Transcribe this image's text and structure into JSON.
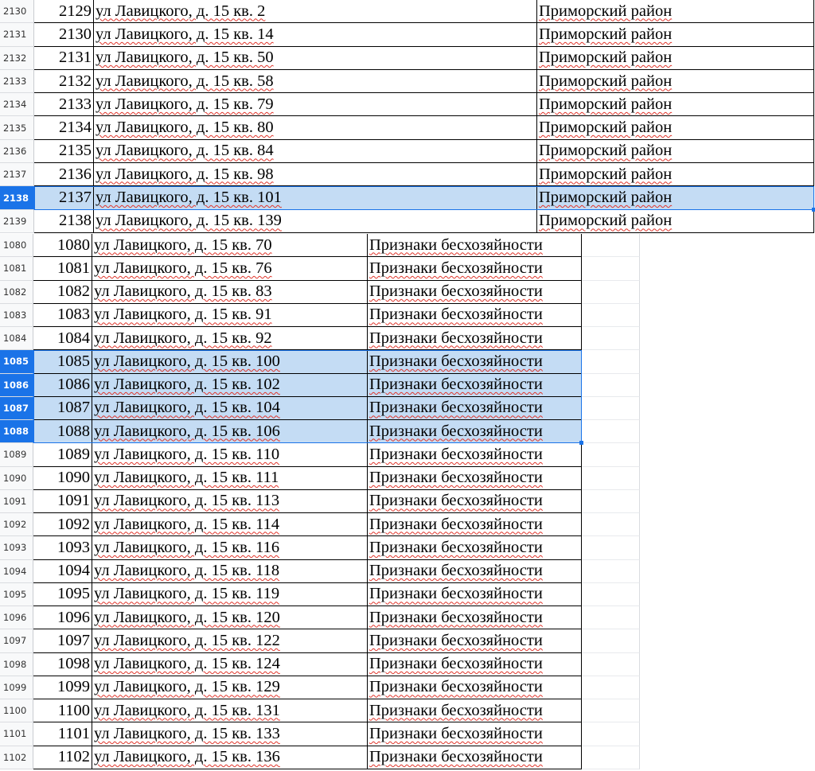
{
  "top_block": {
    "rows": [
      {
        "row": "2130",
        "num": "2129",
        "address": "ул Лавицкого, д. 15 кв. 2",
        "district": "Приморский район",
        "selected": false
      },
      {
        "row": "2131",
        "num": "2130",
        "address": "ул Лавицкого, д. 15 кв. 14",
        "district": "Приморский район",
        "selected": false
      },
      {
        "row": "2132",
        "num": "2131",
        "address": "ул Лавицкого, д. 15 кв. 50",
        "district": "Приморский район",
        "selected": false
      },
      {
        "row": "2133",
        "num": "2132",
        "address": "ул Лавицкого, д. 15 кв. 58",
        "district": "Приморский район",
        "selected": false
      },
      {
        "row": "2134",
        "num": "2133",
        "address": "ул Лавицкого, д. 15 кв. 79",
        "district": "Приморский район",
        "selected": false
      },
      {
        "row": "2135",
        "num": "2134",
        "address": "ул Лавицкого, д. 15 кв. 80",
        "district": "Приморский район",
        "selected": false
      },
      {
        "row": "2136",
        "num": "2135",
        "address": "ул Лавицкого, д. 15 кв. 84",
        "district": "Приморский район",
        "selected": false
      },
      {
        "row": "2137",
        "num": "2136",
        "address": "ул Лавицкого, д. 15 кв. 98",
        "district": "Приморский район",
        "selected": false
      },
      {
        "row": "2138",
        "num": "2137",
        "address": "ул Лавицкого, д. 15 кв. 101",
        "district": "Приморский район",
        "selected": true
      },
      {
        "row": "2139",
        "num": "2138",
        "address": "ул Лавицкого, д. 15 кв. 139",
        "district": "Приморский район",
        "selected": false
      }
    ]
  },
  "bottom_block": {
    "rows": [
      {
        "row": "1080",
        "num": "1080",
        "address": "ул Лавицкого, д. 15 кв. 70",
        "status": "Признаки бесхозяйности",
        "selected": false
      },
      {
        "row": "1081",
        "num": "1081",
        "address": "ул Лавицкого, д. 15 кв. 76",
        "status": "Признаки бесхозяйности",
        "selected": false
      },
      {
        "row": "1082",
        "num": "1082",
        "address": "ул Лавицкого, д. 15 кв. 83",
        "status": "Признаки бесхозяйности",
        "selected": false
      },
      {
        "row": "1083",
        "num": "1083",
        "address": "ул Лавицкого, д. 15 кв. 91",
        "status": "Признаки бесхозяйности",
        "selected": false
      },
      {
        "row": "1084",
        "num": "1084",
        "address": "ул Лавицкого, д. 15 кв. 92",
        "status": "Признаки бесхозяйности",
        "selected": false
      },
      {
        "row": "1085",
        "num": "1085",
        "address": "ул Лавицкого, д. 15 кв. 100",
        "status": "Признаки бесхозяйности",
        "selected": true
      },
      {
        "row": "1086",
        "num": "1086",
        "address": "ул Лавицкого, д. 15 кв. 102",
        "status": "Признаки бесхозяйности",
        "selected": true
      },
      {
        "row": "1087",
        "num": "1087",
        "address": "ул Лавицкого, д. 15 кв. 104",
        "status": "Признаки бесхозяйности",
        "selected": true
      },
      {
        "row": "1088",
        "num": "1088",
        "address": "ул Лавицкого, д. 15 кв. 106",
        "status": "Признаки бесхозяйности",
        "selected": true
      },
      {
        "row": "1089",
        "num": "1089",
        "address": "ул Лавицкого, д. 15 кв. 110",
        "status": "Признаки бесхозяйности",
        "selected": false
      },
      {
        "row": "1090",
        "num": "1090",
        "address": "ул Лавицкого, д. 15 кв. 111",
        "status": "Признаки бесхозяйности",
        "selected": false
      },
      {
        "row": "1091",
        "num": "1091",
        "address": "ул Лавицкого, д. 15 кв. 113",
        "status": "Признаки бесхозяйности",
        "selected": false
      },
      {
        "row": "1092",
        "num": "1092",
        "address": "ул Лавицкого, д. 15 кв. 114",
        "status": "Признаки бесхозяйности",
        "selected": false
      },
      {
        "row": "1093",
        "num": "1093",
        "address": "ул Лавицкого, д. 15 кв. 116",
        "status": "Признаки бесхозяйности",
        "selected": false
      },
      {
        "row": "1094",
        "num": "1094",
        "address": "ул Лавицкого, д. 15 кв. 118",
        "status": "Признаки бесхозяйности",
        "selected": false
      },
      {
        "row": "1095",
        "num": "1095",
        "address": "ул Лавицкого, д. 15 кв. 119",
        "status": "Признаки бесхозяйности",
        "selected": false
      },
      {
        "row": "1096",
        "num": "1096",
        "address": "ул Лавицкого, д. 15 кв. 120",
        "status": "Признаки бесхозяйности",
        "selected": false
      },
      {
        "row": "1097",
        "num": "1097",
        "address": "ул Лавицкого, д. 15 кв. 122",
        "status": "Признаки бесхозяйности",
        "selected": false
      },
      {
        "row": "1098",
        "num": "1098",
        "address": "ул Лавицкого, д. 15 кв. 124",
        "status": "Признаки бесхозяйности",
        "selected": false
      },
      {
        "row": "1099",
        "num": "1099",
        "address": "ул Лавицкого, д. 15 кв. 129",
        "status": "Признаки бесхозяйности",
        "selected": false
      },
      {
        "row": "1100",
        "num": "1100",
        "address": "ул Лавицкого, д. 15 кв. 131",
        "status": "Признаки бесхозяйности",
        "selected": false
      },
      {
        "row": "1101",
        "num": "1101",
        "address": "ул Лавицкого, д. 15 кв. 133",
        "status": "Признаки бесхозяйности",
        "selected": false
      },
      {
        "row": "1102",
        "num": "1102",
        "address": "ул Лавицкого, д. 15 кв. 136",
        "status": "Признаки бесхозяйности",
        "selected": false
      }
    ]
  },
  "colors": {
    "selection_border": "#1a73e8",
    "selection_fill": "#c4dcf4",
    "spellcheck": "#e0352b"
  }
}
